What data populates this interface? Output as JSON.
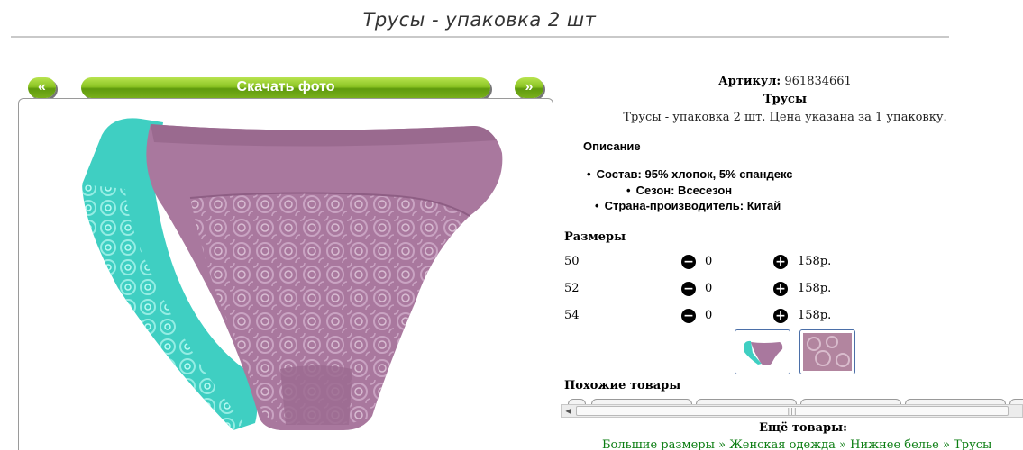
{
  "page": {
    "title": "Трусы - упаковка 2 шт"
  },
  "nav": {
    "prev_label": "«",
    "download_label": "Скачать фото",
    "next_label": "»"
  },
  "product": {
    "article_label": "Артикул:",
    "article_value": "961834661",
    "name": "Трусы",
    "description": "Трусы - упаковка 2 шт. Цена указана за 1 упаковку.",
    "spec_heading": "Описание",
    "specs": [
      "Состав: 95% хлопок, 5% спандекс",
      "Сезон: Всесезон",
      "Страна-производитель: Китай"
    ]
  },
  "sizes": {
    "heading": "Размеры",
    "rows": [
      {
        "size": "50",
        "qty": "0",
        "price": "158р."
      },
      {
        "size": "52",
        "qty": "0",
        "price": "158р."
      },
      {
        "size": "54",
        "qty": "0",
        "price": "158р."
      }
    ],
    "minus_icon": "minus-circle-icon",
    "plus_icon": "plus-circle-icon"
  },
  "thumbnails": [
    "thumbnail-panties-front",
    "thumbnail-lace-closeup"
  ],
  "similar": {
    "heading": "Похожие товары"
  },
  "more": {
    "heading": "Ещё товары:",
    "breadcrumb": [
      "Большие размеры",
      "Женская одежда",
      "Нижнее белье",
      "Трусы"
    ],
    "separator": "»"
  },
  "colors": {
    "button_green": "#8cc424",
    "link_green": "#0b7d12",
    "fabric_teal": "#3fcfc2",
    "fabric_mauve": "#a9789e",
    "thumb_border": "#4b6fa8"
  }
}
